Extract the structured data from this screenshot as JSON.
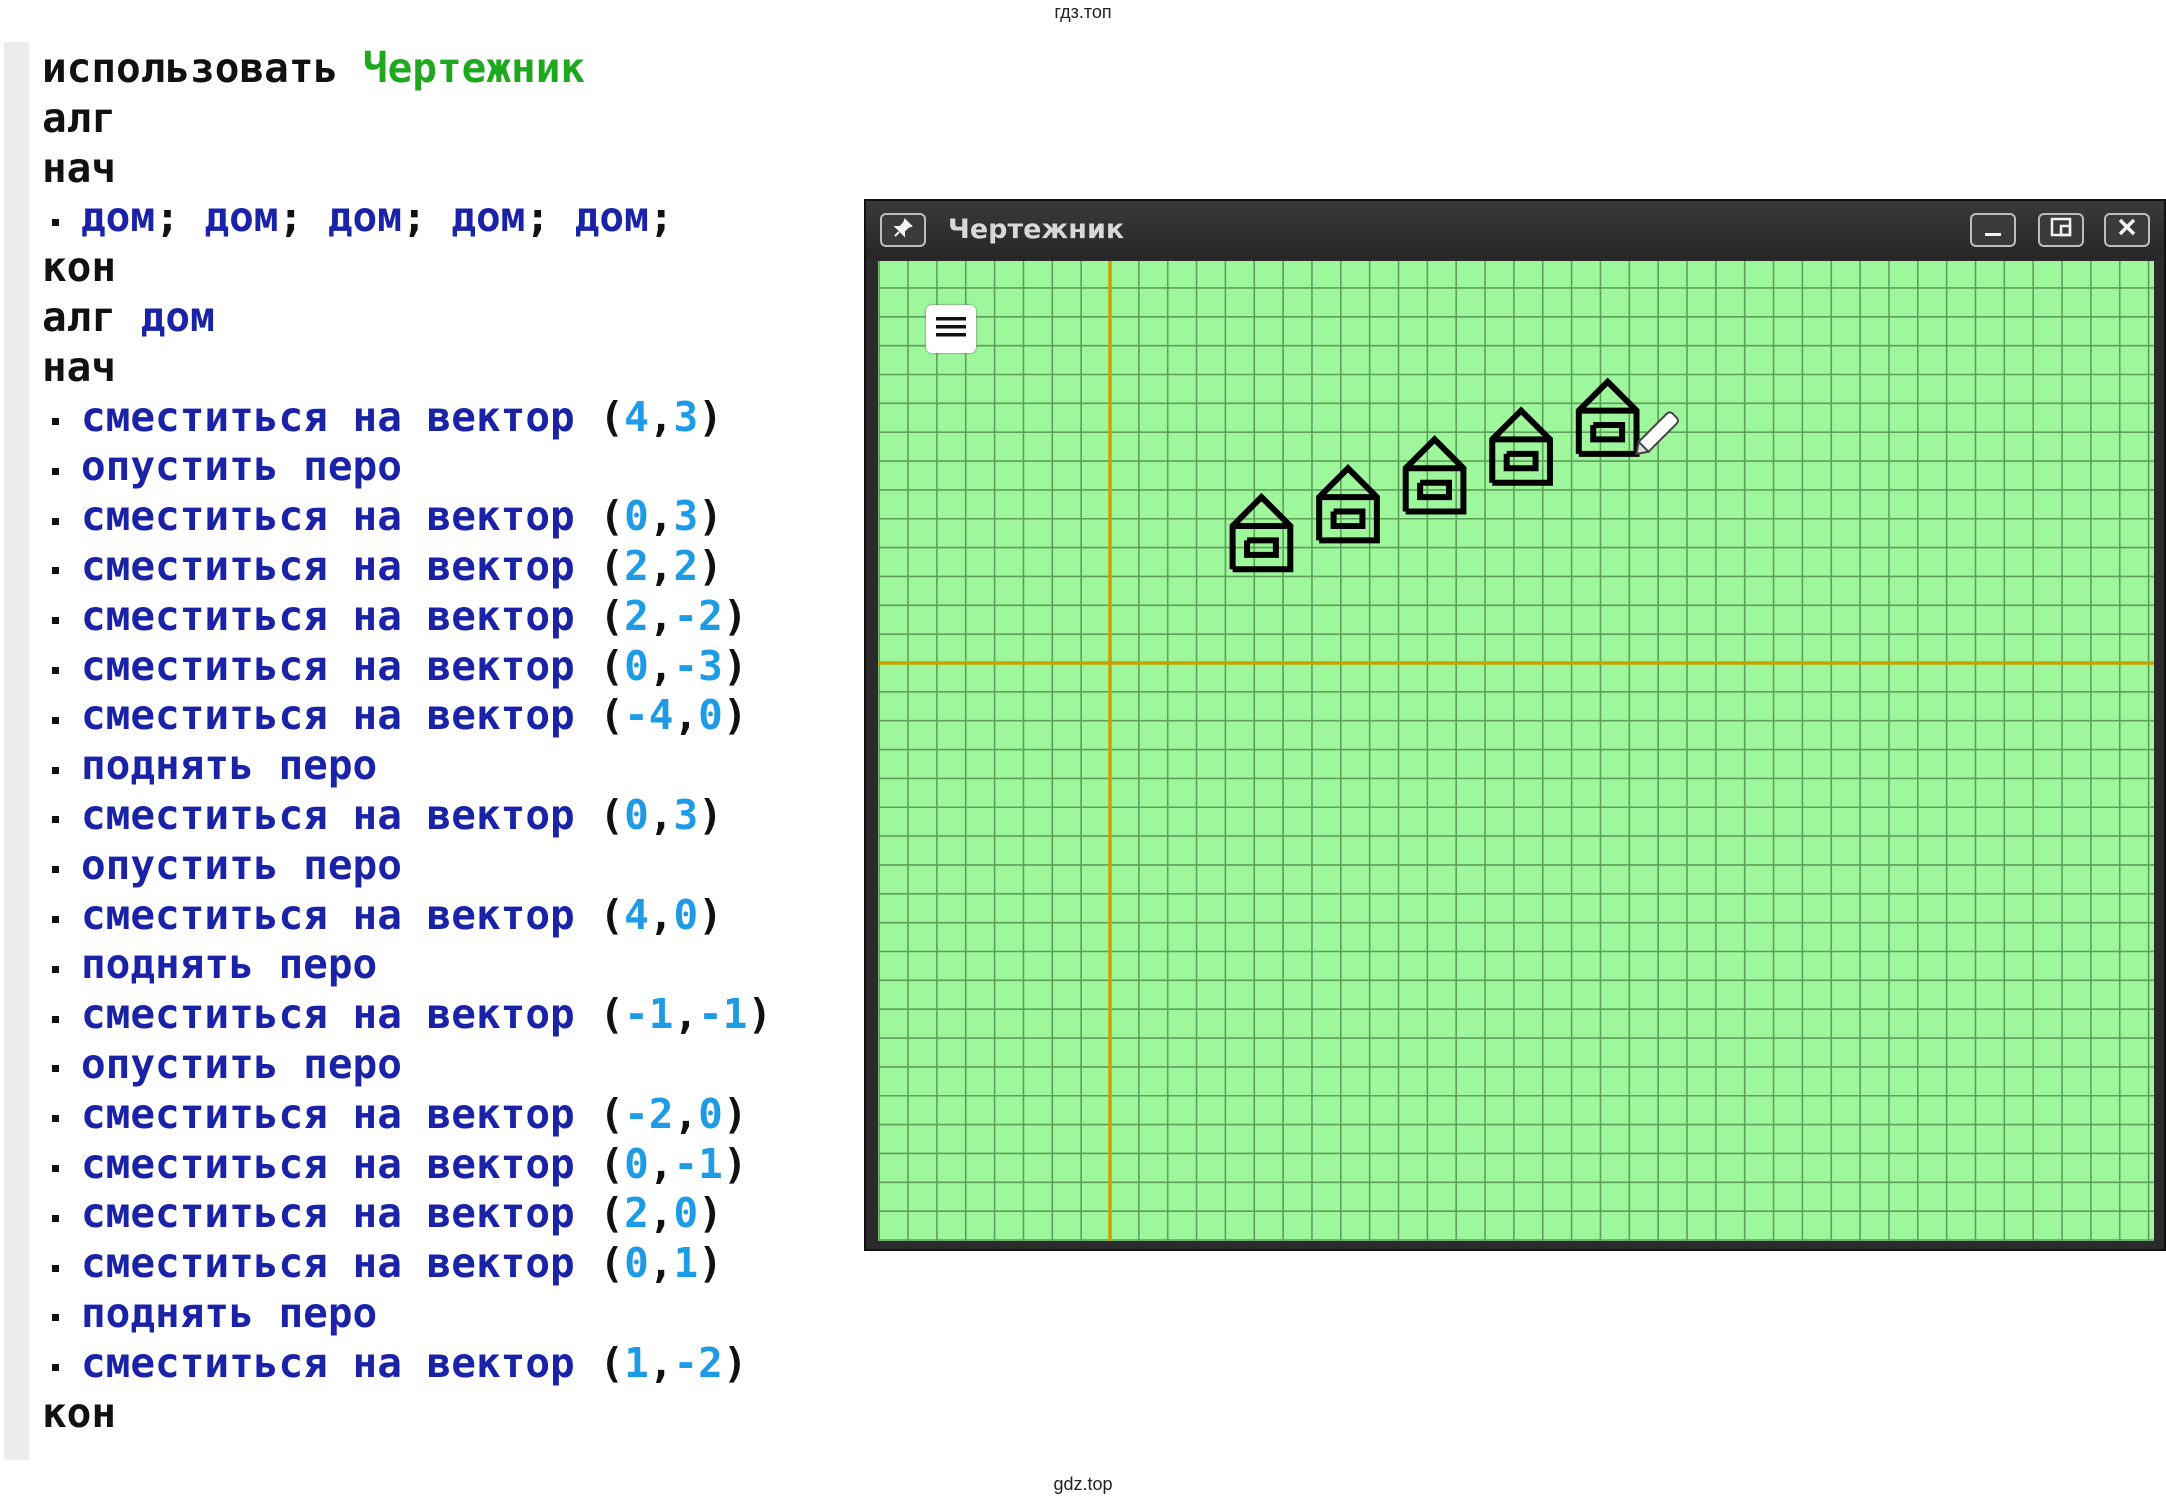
{
  "watermark": {
    "top": "гдз.топ",
    "bottom": "gdz.top"
  },
  "code": {
    "lines": [
      {
        "indent": false,
        "tokens": [
          {
            "t": "использовать",
            "c": "kw"
          },
          {
            "t": " ",
            "c": "kw"
          },
          {
            "t": "Чертежник",
            "c": "mod"
          }
        ]
      },
      {
        "indent": false,
        "tokens": [
          {
            "t": "алг",
            "c": "kw"
          }
        ]
      },
      {
        "indent": false,
        "tokens": [
          {
            "t": "нач",
            "c": "kw"
          }
        ]
      },
      {
        "indent": true,
        "tokens": [
          {
            "t": "дом",
            "c": "cmd"
          },
          {
            "t": "; ",
            "c": "punct"
          },
          {
            "t": "дом",
            "c": "cmd"
          },
          {
            "t": "; ",
            "c": "punct"
          },
          {
            "t": "дом",
            "c": "cmd"
          },
          {
            "t": "; ",
            "c": "punct"
          },
          {
            "t": "дом",
            "c": "cmd"
          },
          {
            "t": "; ",
            "c": "punct"
          },
          {
            "t": "дом",
            "c": "cmd"
          },
          {
            "t": ";",
            "c": "punct"
          }
        ]
      },
      {
        "indent": false,
        "tokens": [
          {
            "t": "кон",
            "c": "kw"
          }
        ]
      },
      {
        "indent": false,
        "tokens": [
          {
            "t": "алг ",
            "c": "kw"
          },
          {
            "t": "дом",
            "c": "cmd"
          }
        ]
      },
      {
        "indent": false,
        "tokens": [
          {
            "t": "нач",
            "c": "kw"
          }
        ]
      },
      {
        "indent": true,
        "tokens": [
          {
            "t": "сместиться на вектор ",
            "c": "cmd"
          },
          {
            "t": "(",
            "c": "punct"
          },
          {
            "t": "4",
            "c": "num"
          },
          {
            "t": ",",
            "c": "punct"
          },
          {
            "t": "3",
            "c": "num"
          },
          {
            "t": ")",
            "c": "punct"
          }
        ]
      },
      {
        "indent": true,
        "tokens": [
          {
            "t": "опустить перо",
            "c": "cmd"
          }
        ]
      },
      {
        "indent": true,
        "tokens": [
          {
            "t": "сместиться на вектор ",
            "c": "cmd"
          },
          {
            "t": "(",
            "c": "punct"
          },
          {
            "t": "0",
            "c": "num"
          },
          {
            "t": ",",
            "c": "punct"
          },
          {
            "t": "3",
            "c": "num"
          },
          {
            "t": ")",
            "c": "punct"
          }
        ]
      },
      {
        "indent": true,
        "tokens": [
          {
            "t": "сместиться на вектор ",
            "c": "cmd"
          },
          {
            "t": "(",
            "c": "punct"
          },
          {
            "t": "2",
            "c": "num"
          },
          {
            "t": ",",
            "c": "punct"
          },
          {
            "t": "2",
            "c": "num"
          },
          {
            "t": ")",
            "c": "punct"
          }
        ]
      },
      {
        "indent": true,
        "tokens": [
          {
            "t": "сместиться на вектор ",
            "c": "cmd"
          },
          {
            "t": "(",
            "c": "punct"
          },
          {
            "t": "2",
            "c": "num"
          },
          {
            "t": ",",
            "c": "punct"
          },
          {
            "t": "-2",
            "c": "num"
          },
          {
            "t": ")",
            "c": "punct"
          }
        ]
      },
      {
        "indent": true,
        "tokens": [
          {
            "t": "сместиться на вектор ",
            "c": "cmd"
          },
          {
            "t": "(",
            "c": "punct"
          },
          {
            "t": "0",
            "c": "num"
          },
          {
            "t": ",",
            "c": "punct"
          },
          {
            "t": "-3",
            "c": "num"
          },
          {
            "t": ")",
            "c": "punct"
          }
        ]
      },
      {
        "indent": true,
        "tokens": [
          {
            "t": "сместиться на вектор ",
            "c": "cmd"
          },
          {
            "t": "(",
            "c": "punct"
          },
          {
            "t": "-4",
            "c": "num"
          },
          {
            "t": ",",
            "c": "punct"
          },
          {
            "t": "0",
            "c": "num"
          },
          {
            "t": ")",
            "c": "punct"
          }
        ]
      },
      {
        "indent": true,
        "tokens": [
          {
            "t": "поднять перо",
            "c": "cmd"
          }
        ]
      },
      {
        "indent": true,
        "tokens": [
          {
            "t": "сместиться на вектор ",
            "c": "cmd"
          },
          {
            "t": "(",
            "c": "punct"
          },
          {
            "t": "0",
            "c": "num"
          },
          {
            "t": ",",
            "c": "punct"
          },
          {
            "t": "3",
            "c": "num"
          },
          {
            "t": ")",
            "c": "punct"
          }
        ]
      },
      {
        "indent": true,
        "tokens": [
          {
            "t": "опустить перо",
            "c": "cmd"
          }
        ]
      },
      {
        "indent": true,
        "tokens": [
          {
            "t": "сместиться на вектор ",
            "c": "cmd"
          },
          {
            "t": "(",
            "c": "punct"
          },
          {
            "t": "4",
            "c": "num"
          },
          {
            "t": ",",
            "c": "punct"
          },
          {
            "t": "0",
            "c": "num"
          },
          {
            "t": ")",
            "c": "punct"
          }
        ]
      },
      {
        "indent": true,
        "tokens": [
          {
            "t": "поднять перо",
            "c": "cmd"
          }
        ]
      },
      {
        "indent": true,
        "tokens": [
          {
            "t": "сместиться на вектор ",
            "c": "cmd"
          },
          {
            "t": "(",
            "c": "punct"
          },
          {
            "t": "-1",
            "c": "num"
          },
          {
            "t": ",",
            "c": "punct"
          },
          {
            "t": "-1",
            "c": "num"
          },
          {
            "t": ")",
            "c": "punct"
          }
        ]
      },
      {
        "indent": true,
        "tokens": [
          {
            "t": "опустить перо",
            "c": "cmd"
          }
        ]
      },
      {
        "indent": true,
        "tokens": [
          {
            "t": "сместиться на вектор ",
            "c": "cmd"
          },
          {
            "t": "(",
            "c": "punct"
          },
          {
            "t": "-2",
            "c": "num"
          },
          {
            "t": ",",
            "c": "punct"
          },
          {
            "t": "0",
            "c": "num"
          },
          {
            "t": ")",
            "c": "punct"
          }
        ]
      },
      {
        "indent": true,
        "tokens": [
          {
            "t": "сместиться на вектор ",
            "c": "cmd"
          },
          {
            "t": "(",
            "c": "punct"
          },
          {
            "t": "0",
            "c": "num"
          },
          {
            "t": ",",
            "c": "punct"
          },
          {
            "t": "-1",
            "c": "num"
          },
          {
            "t": ")",
            "c": "punct"
          }
        ]
      },
      {
        "indent": true,
        "tokens": [
          {
            "t": "сместиться на вектор ",
            "c": "cmd"
          },
          {
            "t": "(",
            "c": "punct"
          },
          {
            "t": "2",
            "c": "num"
          },
          {
            "t": ",",
            "c": "punct"
          },
          {
            "t": "0",
            "c": "num"
          },
          {
            "t": ")",
            "c": "punct"
          }
        ]
      },
      {
        "indent": true,
        "tokens": [
          {
            "t": "сместиться на вектор ",
            "c": "cmd"
          },
          {
            "t": "(",
            "c": "punct"
          },
          {
            "t": "0",
            "c": "num"
          },
          {
            "t": ",",
            "c": "punct"
          },
          {
            "t": "1",
            "c": "num"
          },
          {
            "t": ")",
            "c": "punct"
          }
        ]
      },
      {
        "indent": true,
        "tokens": [
          {
            "t": "поднять перо",
            "c": "cmd"
          }
        ]
      },
      {
        "indent": true,
        "tokens": [
          {
            "t": "сместиться на вектор ",
            "c": "cmd"
          },
          {
            "t": "(",
            "c": "punct"
          },
          {
            "t": "1",
            "c": "num"
          },
          {
            "t": ",",
            "c": "punct"
          },
          {
            "t": "-2",
            "c": "num"
          },
          {
            "t": ")",
            "c": "punct"
          }
        ]
      },
      {
        "indent": false,
        "tokens": [
          {
            "t": "кон",
            "c": "kw"
          }
        ]
      }
    ]
  },
  "window": {
    "title": "Чертежник",
    "buttons": {
      "pin": "pin-icon",
      "minimize": "minimize-icon",
      "restore": "restore-icon",
      "close": "close-icon"
    },
    "menu_icon": "hamburger-menu-icon"
  },
  "drawing": {
    "background": "#9ef79a",
    "grid_color": "#5f9e5c",
    "axis_color": "#c9a000",
    "stroke_color": "#000000",
    "house_count": 5,
    "house_step": [
      3,
      1
    ],
    "house_shape": [
      [
        [
          0,
          0
        ],
        [
          0,
          3
        ],
        [
          2,
          5
        ],
        [
          4,
          3
        ],
        [
          4,
          0
        ],
        [
          0,
          0
        ]
      ],
      [
        [
          0,
          3
        ],
        [
          4,
          3
        ]
      ],
      [
        [
          1,
          2
        ],
        [
          3,
          2
        ],
        [
          3,
          1
        ],
        [
          1,
          1
        ],
        [
          1,
          2
        ]
      ]
    ],
    "first_house_origin": [
      4,
      3
    ],
    "pen_position": [
      16,
      5
    ]
  }
}
